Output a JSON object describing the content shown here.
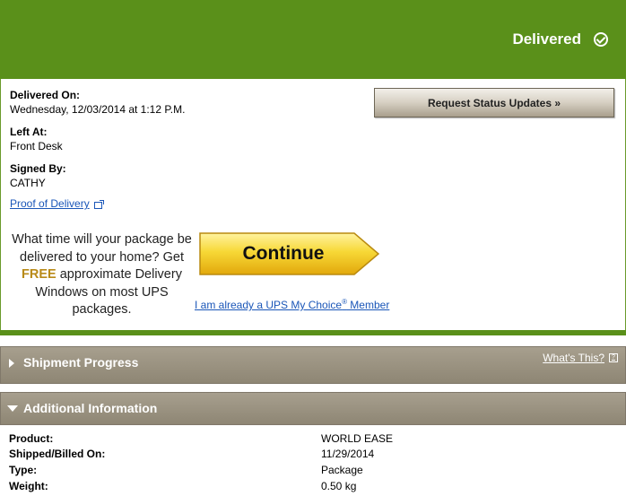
{
  "header": {
    "status": "Delivered"
  },
  "delivery": {
    "delivered_on_label": "Delivered On:",
    "delivered_on_value": "Wednesday,  12/03/2014 at 1:12 P.M.",
    "left_at_label": "Left At:",
    "left_at_value": "Front Desk",
    "signed_by_label": "Signed By:",
    "signed_by_value": "CATHY",
    "proof_link": "Proof of Delivery"
  },
  "request_button": "Request Status Updates »",
  "promo": {
    "line1": "What time will your package be delivered to your home? Get ",
    "free": "FREE",
    "line2": " approximate Delivery Windows on most UPS packages.",
    "continue_label": "Continue",
    "member_text": "I am already a UPS My Choice",
    "member_reg": "®",
    "member_suffix": " Member"
  },
  "shipment_progress": {
    "title": "Shipment Progress",
    "whats_this": "What's This?"
  },
  "additional_info": {
    "title": "Additional Information",
    "rows": [
      {
        "label": "Product:",
        "value": "WORLD EASE"
      },
      {
        "label": "Shipped/Billed On:",
        "value": "11/29/2014"
      },
      {
        "label": "Type:",
        "value": "Package"
      },
      {
        "label": "Weight:",
        "value": "0.50 kg"
      }
    ]
  },
  "colors": {
    "brand_green": "#5a901a",
    "section_tan": "#958d7b",
    "link_blue": "#1a56b8",
    "cta_yellow": "#f5cf2a"
  }
}
